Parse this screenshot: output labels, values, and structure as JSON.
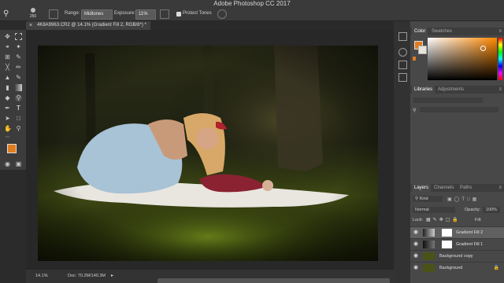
{
  "app_title": "Adobe Photoshop CC 2017",
  "options_bar": {
    "brush_size": "250",
    "range_label": "Range:",
    "range_value": "Midtones",
    "exposure_label": "Exposure:",
    "exposure_value": "11%",
    "protect_tones_label": "Protect Tones"
  },
  "document_tab": "4K8A9963.CR2 @ 14.1% (Gradient Fill 2, RGB/8*) *",
  "status": {
    "zoom": "14.1%",
    "doc_size": "Doc: 70.2M/140.3M"
  },
  "colors": {
    "foreground": "#e07c1f",
    "background": "#e8e4dc"
  },
  "panels": {
    "color_tabs": [
      "Color",
      "Swatches"
    ],
    "libraries_tabs": [
      "Libraries",
      "Adjustments"
    ],
    "layers_tabs": [
      "Layers",
      "Channels",
      "Paths"
    ],
    "filter_kind": "Kind",
    "blend_mode": "Normal",
    "opacity_label": "Opacity:",
    "opacity_value": "100%",
    "lock_label": "Lock:",
    "fill_label": "Fill:"
  },
  "layers": [
    {
      "name": "Gradient Fill 2",
      "selected": true
    },
    {
      "name": "Gradient Fill 1",
      "selected": false
    },
    {
      "name": "Background copy",
      "selected": false
    },
    {
      "name": "Background",
      "selected": false
    }
  ],
  "icons": {
    "toolbar": [
      "move-icon",
      "marquee-icon",
      "lasso-icon",
      "magic-wand-icon",
      "crop-icon",
      "eyedropper-icon",
      "healing-icon",
      "brush-icon",
      "stamp-icon",
      "history-brush-icon",
      "eraser-icon",
      "gradient-icon",
      "dodge-icon",
      "pen-icon",
      "type-icon",
      "path-select-icon",
      "rectangle-icon",
      "hand-icon",
      "zoom-icon"
    ]
  }
}
